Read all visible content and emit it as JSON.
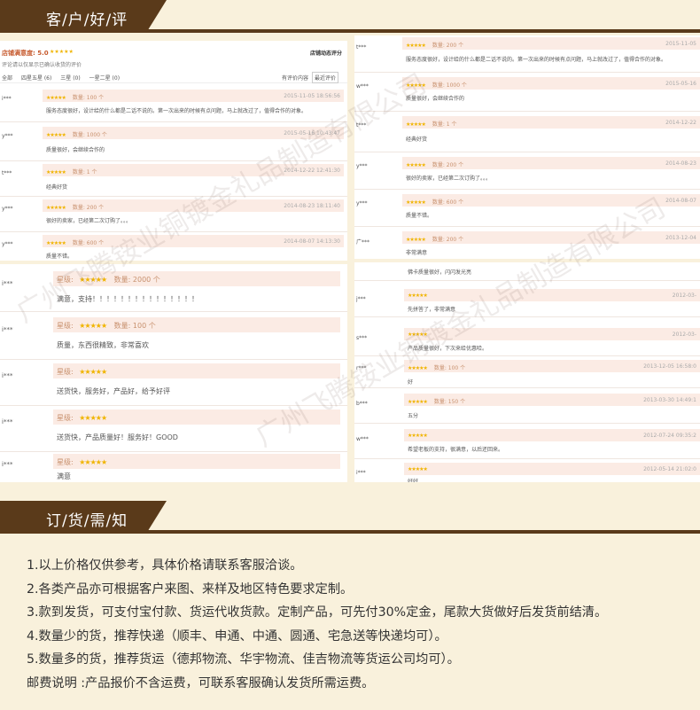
{
  "sections": {
    "reviews_title": "客/户/好/评",
    "notice_title": "订/货/需/知"
  },
  "toolbar": {
    "score_label": "店铺满意度: 5.0",
    "score_stars": "★★★★★",
    "subtitle": "评论请以仅显示已确认收货的评价",
    "filters": [
      "全部",
      "四星五星 (6)",
      "三星 (0)",
      "一星二星 (0)"
    ],
    "dropdown": "店铺动态评分",
    "has_content": "有评价内容",
    "sort": "最近评价"
  },
  "watermark": "广州飞腾铵业铜镀金礼品制造有限公司",
  "left_reviews": [
    {
      "user": "i***",
      "stars": "★★★★★",
      "qty": "数量: 100 个",
      "date": "2015-11-05 18:56:56",
      "text": "服务态度很好，设计给的什么都是二话不说的。第一次出来的时候有点问题，马上就改过了，值得合作的对象。"
    },
    {
      "user": "y***",
      "stars": "★★★★★",
      "qty": "数量: 1000 个",
      "date": "2015-05-16 10:43:47",
      "text": "质量很好，会继续合作的"
    },
    {
      "user": "t***",
      "stars": "★★★★★",
      "qty": "数量: 1 个",
      "date": "2014-12-22 12:41:30",
      "text": "经典好货"
    },
    {
      "user": "y***",
      "stars": "★★★★★",
      "qty": "数量: 200 个",
      "date": "2014-08-23 18:11:40",
      "text": "很好的卖家，已经第二次订购了。。。"
    },
    {
      "user": "y***",
      "stars": "★★★★★",
      "qty": "数量: 600 个",
      "date": "2014-08-07 14:13:30",
      "text": "质量不错。"
    }
  ],
  "left_big_reviews": [
    {
      "user": "i***",
      "star_label": "星级:",
      "stars": "★★★★★",
      "qty": "数量: 2000 个",
      "text": "满意，支持！！！！！！！！！！！！！！！"
    },
    {
      "user": "i***",
      "star_label": "星级:",
      "stars": "★★★★★",
      "qty": "数量: 100 个",
      "text": "质量，东西很精致，非常喜欢"
    },
    {
      "user": "i***",
      "star_label": "星级:",
      "stars": "★★★★★",
      "qty": "",
      "text": "送货快，服务好，产品好，给予好评"
    },
    {
      "user": "i***",
      "star_label": "星级:",
      "stars": "★★★★★",
      "qty": "",
      "text": "送货快，产品质量好！服务好！GOOD"
    },
    {
      "user": "i***",
      "star_label": "星级:",
      "stars": "★★★★★",
      "qty": "",
      "text": "满意"
    }
  ],
  "right_reviews": [
    {
      "user": "t***",
      "stars": "★★★★★",
      "qty": "数量: 200 个",
      "date": "2015-11-05",
      "text": "服务态度很好，设计给的什么都是二话不说的。第一次出来的时候有点问题，马上就改过了，值得合作的对象。"
    },
    {
      "user": "w***",
      "stars": "★★★★★",
      "qty": "数量: 1000 个",
      "date": "2015-05-16",
      "text": "质量很好，会继续合作的"
    },
    {
      "user": "t***",
      "stars": "★★★★★",
      "qty": "数量: 1 个",
      "date": "2014-12-22",
      "text": "经典好货"
    },
    {
      "user": "y***",
      "stars": "★★★★★",
      "qty": "数量: 200 个",
      "date": "2014-08-23",
      "text": "很好的卖家，已经第二次订购了。。。"
    },
    {
      "user": "y***",
      "stars": "★★★★★",
      "qty": "数量: 600 个",
      "date": "2014-08-07",
      "text": "质量不错。"
    },
    {
      "user": "广***",
      "stars": "★★★★★",
      "qty": "数量: 200 个",
      "date": "2013-12-04",
      "text": "非常满意"
    }
  ],
  "right_lower": {
    "first_text": "佛卡质量很好，闪闪发光亮",
    "items": [
      {
        "user": "j***",
        "stars": "★★★★★",
        "qty": "",
        "date": "2012-03-",
        "text": "先拼答了，非常满意"
      },
      {
        "user": "s***",
        "stars": "★★★★★",
        "qty": "",
        "date": "2012-03-",
        "text": "产品质量很好，下次来给优惠哈。"
      },
      {
        "user": "r***",
        "stars": "★★★★★",
        "qty": "数量: 100 个",
        "date": "2013-12-05 16:58:0",
        "text": "好"
      },
      {
        "user": "b***",
        "stars": "★★★★★",
        "qty": "数量: 150 个",
        "date": "2013-03-30 14:49:1",
        "text": "五分"
      },
      {
        "user": "w***",
        "stars": "★★★★★",
        "qty": "",
        "date": "2012-07-24 09:35:2",
        "text": "希望老板的支持，很满意，以后还回来。"
      },
      {
        "user": "i***",
        "stars": "★★★★★",
        "qty": "",
        "date": "2012-05-14 21:02:0",
        "text": "好好"
      }
    ]
  },
  "notes": [
    "1.以上价格仅供参考，具体价格请联系客服洽谈。",
    "2.各类产品亦可根据客户来图、来样及地区特色要求定制。",
    "3.款到发货，可支付宝付款、货运代收货款。定制产品，可先付30%定金，尾款大货做好后发货前结清。",
    "4.数量少的货，推荐快递（顺丰、申通、中通、圆通、宅急送等快递均可）。",
    "5.数量多的货，推荐货运（德邦物流、华宇物流、佳吉物流等货运公司均可）。",
    "邮费说明 :产品报价不含运费，可联系客服确认发货所需运费。"
  ]
}
